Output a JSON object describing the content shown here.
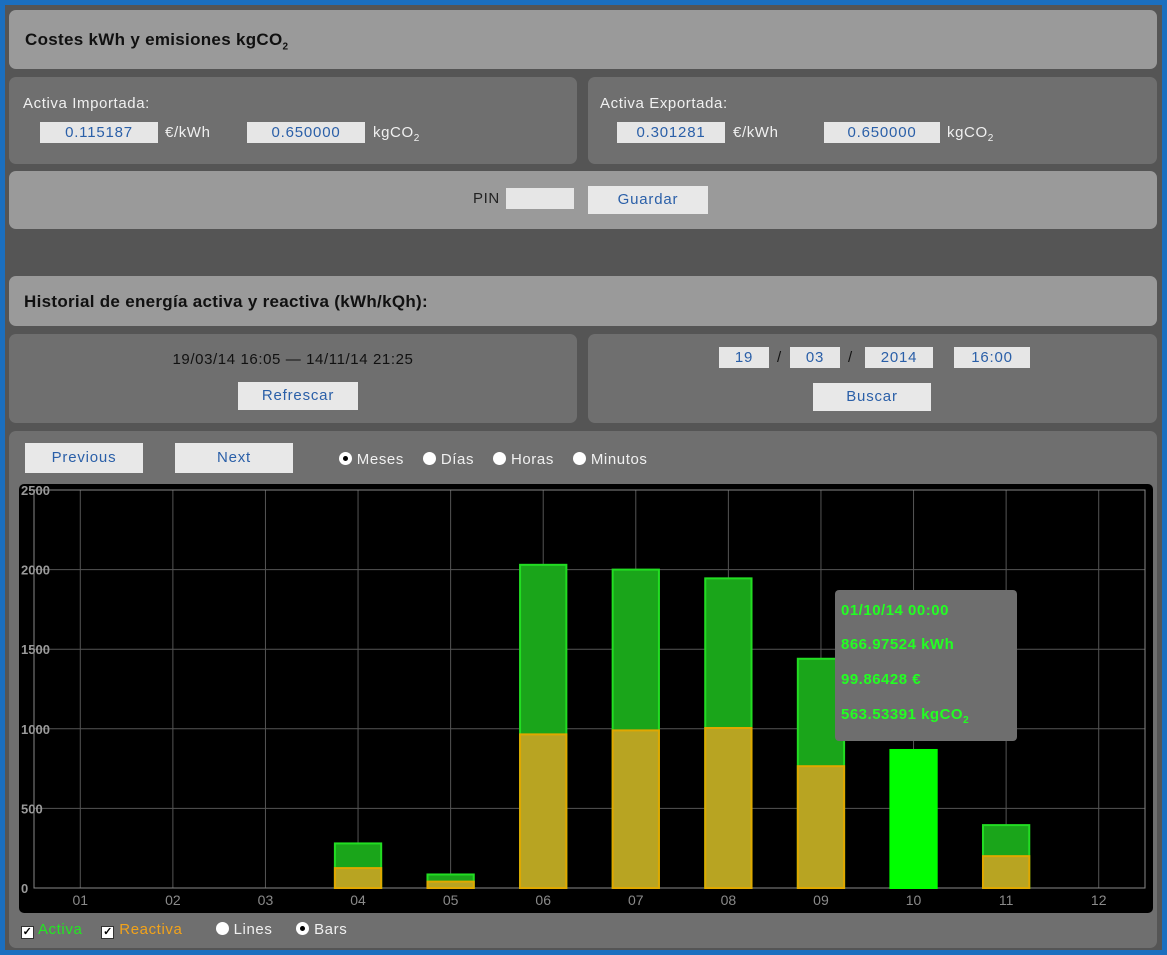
{
  "costs": {
    "title_main": "Costes kWh y emisiones kgCO",
    "title_sub": "2",
    "imported": {
      "label": "Activa Importada:",
      "price": "0.115187",
      "price_unit": "€/kWh",
      "co2": "0.650000",
      "co2_unit_main": "kgCO",
      "co2_unit_sub": "2"
    },
    "exported": {
      "label": "Activa Exportada:",
      "price": "0.301281",
      "price_unit": "€/kWh",
      "co2": "0.650000",
      "co2_unit_main": "kgCO",
      "co2_unit_sub": "2"
    },
    "pin_label": "PIN",
    "pin_value": "",
    "save_label": "Guardar"
  },
  "history": {
    "title": "Historial de energía activa y reactiva (kWh/kQh):",
    "range_text": "19/03/14 16:05 — 14/11/14 21:25",
    "refresh_label": "Refrescar",
    "day": "19",
    "month": "03",
    "year": "2014",
    "time": "16:00",
    "sep1": "/",
    "sep2": "/",
    "search_label": "Buscar",
    "prev_label": "Previous",
    "next_label": "Next",
    "granularity": {
      "options": [
        "Meses",
        "Días",
        "Horas",
        "Minutos"
      ],
      "selected": "Meses"
    },
    "series_toggles": {
      "activa": "Activa",
      "reactiva": "Reactiva",
      "activa_color": "#22e822",
      "reactiva_color": "#f2a31b"
    },
    "style": {
      "options": [
        "Lines",
        "Bars"
      ],
      "selected": "Bars"
    },
    "tooltip": {
      "line1": "01/10/14 00:00",
      "line2": "866.97524 kWh",
      "line3": "99.86428 €",
      "line4_main": "563.53391 kgCO",
      "line4_sub": "2",
      "color": "#22ff22"
    }
  },
  "chart_data": {
    "type": "bar",
    "stacked": true,
    "categories": [
      "01",
      "02",
      "03",
      "04",
      "05",
      "06",
      "07",
      "08",
      "09",
      "10",
      "11",
      "12"
    ],
    "ylim": [
      0,
      2500
    ],
    "yticks": [
      0,
      500,
      1000,
      1500,
      2000,
      2500
    ],
    "grid": true,
    "series": [
      {
        "name": "Activa",
        "values": [
          0,
          0,
          0,
          280,
          85,
          2030,
          2000,
          1945,
          1440,
          867,
          395,
          0
        ],
        "color": "#1aa51a"
      },
      {
        "name": "Reactiva",
        "values": [
          0,
          0,
          0,
          125,
          40,
          965,
          990,
          1005,
          765,
          0,
          200,
          0
        ],
        "color": "#b8a422"
      }
    ],
    "highlight_category": "10",
    "highlight_color": "#00ff00"
  }
}
